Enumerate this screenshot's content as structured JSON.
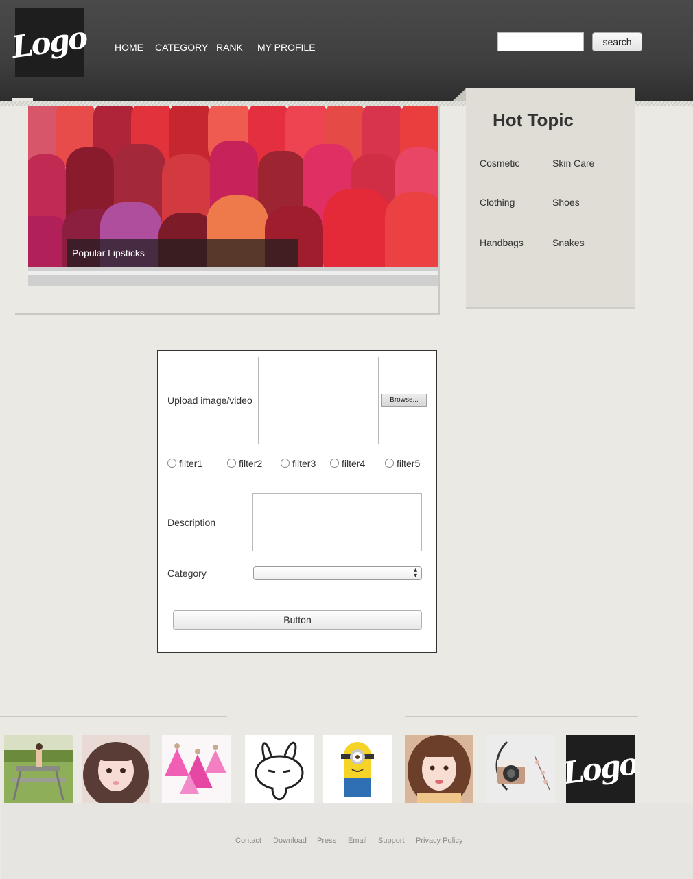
{
  "header": {
    "logo_text": "Logo",
    "nav": [
      "HOME",
      "CATEGORY",
      "RANK",
      "MY PROFILE"
    ],
    "search": {
      "value": "",
      "button_label": "search"
    }
  },
  "hero": {
    "caption": "Popular Lipsticks"
  },
  "sidebar": {
    "title": "Hot Topic",
    "topics": [
      "Cosmetic",
      "Skin Care",
      "Clothing",
      "Shoes",
      "Handbags",
      "Snakes"
    ]
  },
  "form": {
    "upload_label": "Upload image/video",
    "browse_label": "Browse...",
    "filters": [
      "filter1",
      "filter2",
      "filter3",
      "filter4",
      "filter5"
    ],
    "description_label": "Description",
    "category_label": "Category",
    "category_value": "",
    "submit_label": "Button"
  },
  "gallery": {
    "thumbs": [
      "park-photo",
      "girl-portrait",
      "pink-dress-art",
      "rabbit-cartoon",
      "minion-cartoon",
      "girl-selfie",
      "camera-flatlay",
      "logo-thumb"
    ],
    "logo_text": "Logo"
  },
  "footer": {
    "links": [
      "Contact",
      "Download",
      "Press",
      "Email",
      "Support",
      "Privacy Policy"
    ]
  },
  "colors": {
    "header_bg": "#3f3f3f",
    "page_bg": "#eae9e4",
    "sidebar_bg": "#dfddd6",
    "logo_dot": "#2fd26b"
  }
}
